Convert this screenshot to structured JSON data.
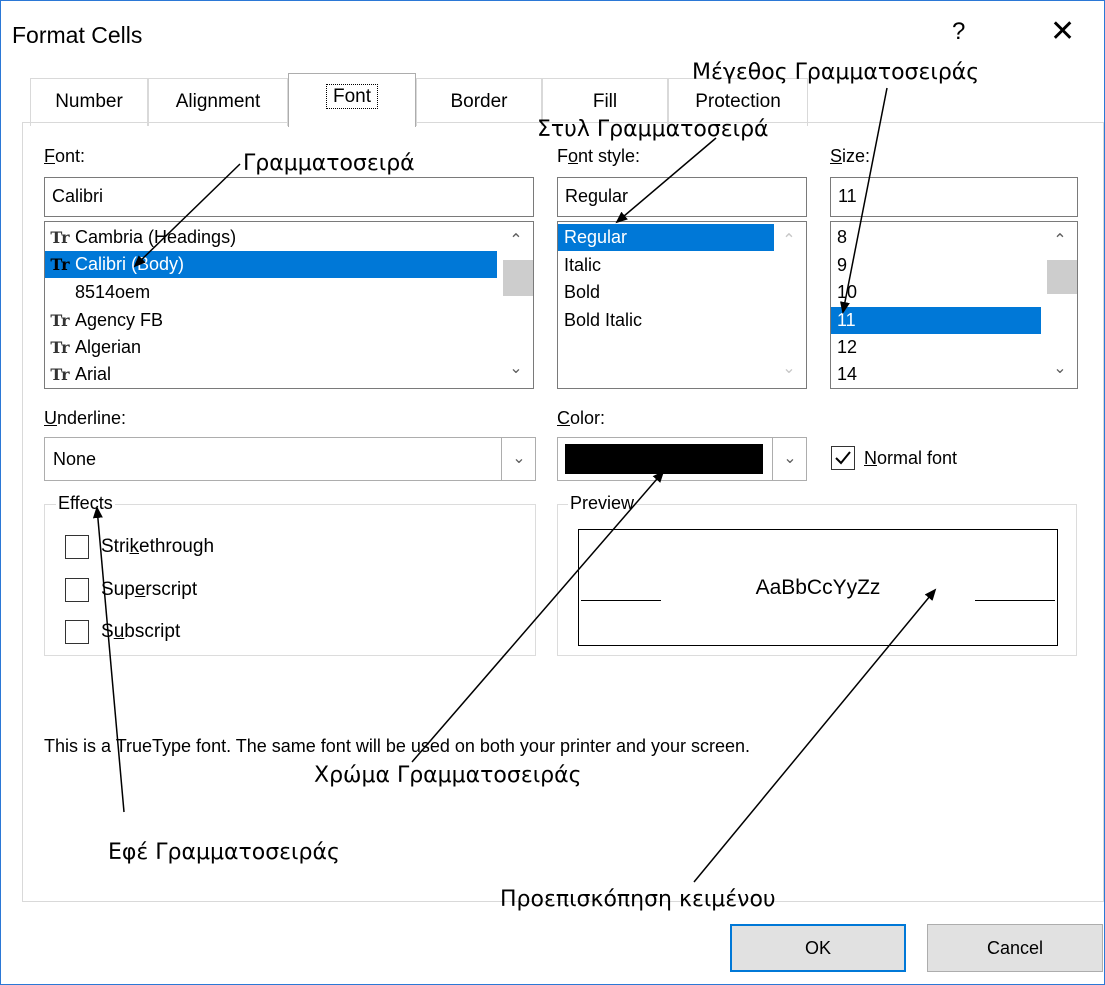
{
  "window": {
    "title": "Format Cells",
    "help_glyph": "?",
    "close_glyph": "✕"
  },
  "tabs": [
    {
      "label": "Number"
    },
    {
      "label": "Alignment"
    },
    {
      "label": "Font",
      "active": true
    },
    {
      "label": "Border"
    },
    {
      "label": "Fill"
    },
    {
      "label": "Protection"
    }
  ],
  "font": {
    "label": "Font:",
    "value": "Calibri",
    "items": [
      "Cambria (Headings)",
      "Calibri (Body)",
      "8514oem",
      "Agency FB",
      "Algerian",
      "Arial"
    ],
    "selected": "Calibri (Body)",
    "tt_glyph": "Tr"
  },
  "font_style": {
    "label": "Font style:",
    "value": "Regular",
    "items": [
      "Regular",
      "Italic",
      "Bold",
      "Bold Italic"
    ],
    "selected": "Regular"
  },
  "size": {
    "label": "Size:",
    "value": "11",
    "items": [
      "8",
      "9",
      "10",
      "11",
      "12",
      "14"
    ],
    "selected": "11"
  },
  "underline": {
    "label": "Underline:",
    "value": "None"
  },
  "color": {
    "label": "Color:",
    "swatch": "#000000"
  },
  "normal_font": {
    "label": "Normal font",
    "checked": true
  },
  "effects": {
    "label": "Effects",
    "strikethrough": "Strikethrough",
    "superscript": "Superscript",
    "subscript": "Subscript"
  },
  "preview": {
    "label": "Preview",
    "sample": "AaBbCcYyZz"
  },
  "info_text": "This is a TrueType font.  The same font will be used on both your printer and your screen.",
  "buttons": {
    "ok": "OK",
    "cancel": "Cancel"
  },
  "annotations": {
    "size": "Μέγεθος Γραμματοσειράς",
    "font_style": "Στυλ Γραμματοσειρά",
    "font": "Γραμματοσειρά",
    "color": "Χρώμα Γραμματοσειράς",
    "effects": "Εφέ Γραμματοσειράς",
    "preview": "Προεπισκόπηση κειμένου"
  },
  "colors": {
    "selection": "#0078d7",
    "window_border": "#2b78d6",
    "ok_border": "#0078d7"
  }
}
